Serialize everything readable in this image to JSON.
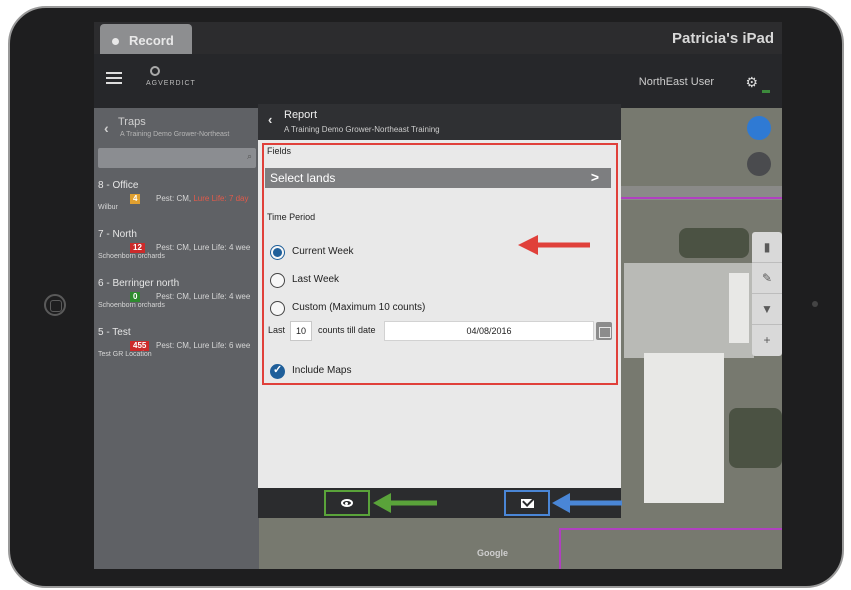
{
  "system_bar": {
    "record_label": "Record",
    "device_name": "Patricia's iPad"
  },
  "app_bar": {
    "logo_text": "AGVERDICT",
    "user_name": "NorthEast User",
    "settings_icon": "gear-icon"
  },
  "traps_panel": {
    "title": "Traps",
    "subtitle": "A Training Demo Grower-Northeast",
    "items": [
      {
        "name": "8 - Office",
        "badge": "4",
        "badge_color": "#e0a030",
        "pest": "Pest: CM,",
        "life": "Lure Life: 7 day",
        "life_color": "#e35a4a",
        "location": "Wilbur"
      },
      {
        "name": "7 - North",
        "badge": "12",
        "badge_color": "#cc2a2a",
        "pest": "Pest: CM,",
        "life": "Lure Life: 4 wee",
        "life_color": "#d6d6d6",
        "location": "Schoenborn orchards"
      },
      {
        "name": "6 - Berringer north",
        "badge": "0",
        "badge_color": "#2e8a2e",
        "pest": "Pest: CM,",
        "life": "Lure Life: 4 wee",
        "life_color": "#d6d6d6",
        "location": "Schoenborn orchards"
      },
      {
        "name": "5 - Test",
        "badge": "455",
        "badge_color": "#cc2a2a",
        "pest": "Pest: CM,",
        "life": "Lure Life: 6 wee",
        "life_color": "#d6d6d6",
        "location": "Test GR Location"
      }
    ]
  },
  "report": {
    "title": "Report",
    "subtitle": "A Training Demo Grower-Northeast Training",
    "fields_label": "Fields",
    "select_lands_label": "Select lands",
    "time_period_label": "Time Period",
    "options": [
      {
        "label": "Current Week",
        "checked": true
      },
      {
        "label": "Last Week",
        "checked": false
      },
      {
        "label": "Custom (Maximum 10 counts)",
        "checked": false
      }
    ],
    "last_label": "Last",
    "count_value": "10",
    "counts_till_label": "counts till date",
    "date_value": "04/08/2016",
    "include_maps_label": "Include Maps",
    "include_maps_checked": true
  },
  "map": {
    "attribution": "Google"
  },
  "annotation_colors": {
    "red": "#e0403a",
    "green": "#5aa33a",
    "blue": "#4a86d6"
  }
}
